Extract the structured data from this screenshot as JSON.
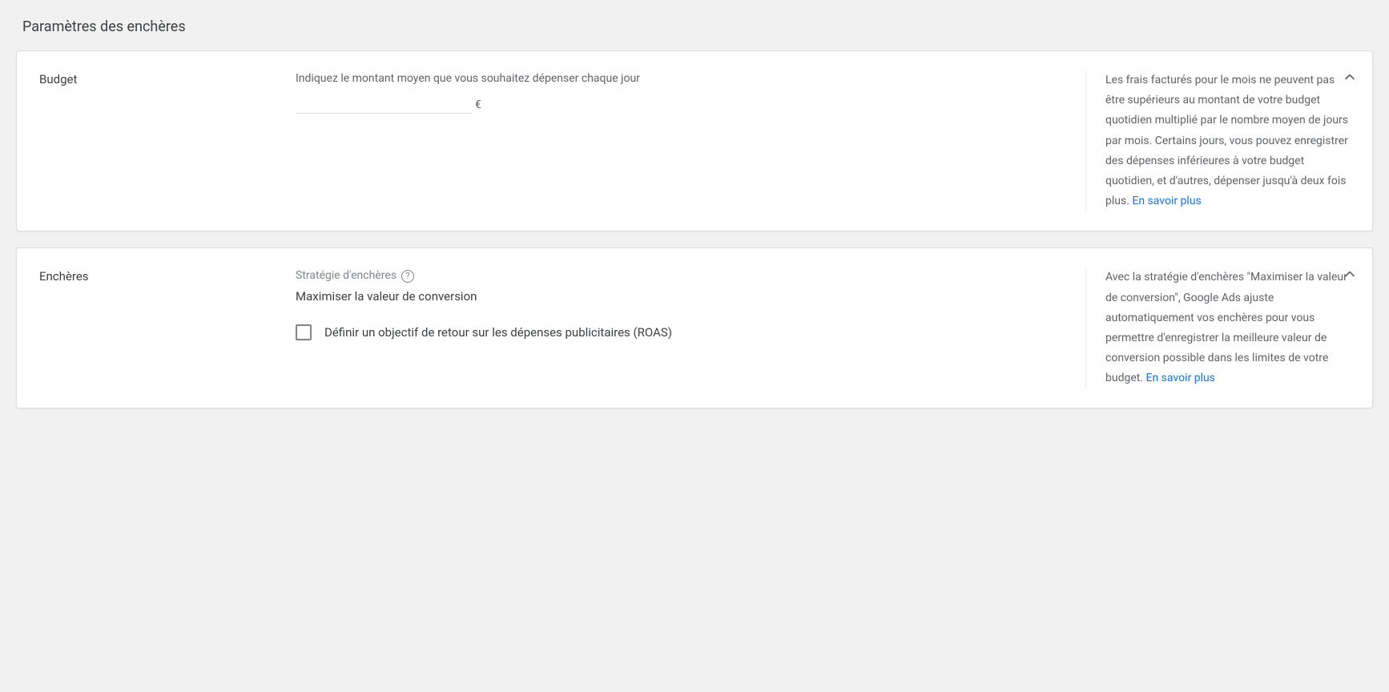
{
  "page_title": "Paramètres des enchères",
  "budget": {
    "label": "Budget",
    "description": "Indiquez le montant moyen que vous souhaitez dépenser chaque jour",
    "currency_symbol": "€",
    "amount_value": "",
    "info_text": "Les frais facturés pour le mois ne peuvent pas être supérieurs au montant de votre budget quotidien multiplié par le nombre moyen de jours par mois. Certains jours, vous pouvez enregistrer des dépenses inférieures à votre budget quotidien, et d'autres, dépenser jusqu'à deux fois plus. ",
    "info_link": "En savoir plus"
  },
  "bidding": {
    "label": "Enchères",
    "strategy_label": "Stratégie d'enchères",
    "strategy_value": "Maximiser la valeur de conversion",
    "checkbox_label": "Définir un objectif de retour sur les dépenses publicitaires (ROAS)",
    "info_text": "Avec la stratégie d'enchères \"Maximiser la valeur de conversion\", Google Ads ajuste automatiquement vos enchères pour vous permettre d'enregistrer la meilleure valeur de conversion possible dans les limites de votre budget. ",
    "info_link": "En savoir plus"
  }
}
